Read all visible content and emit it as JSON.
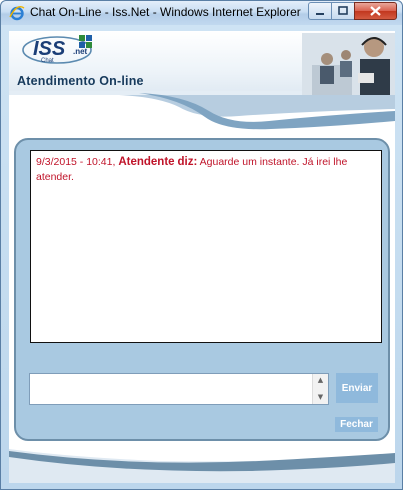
{
  "window": {
    "title": "Chat On-Line - Iss.Net - Windows Internet Explorer"
  },
  "header": {
    "logo_text": "ISS",
    "logo_suffix": ".net",
    "logo_subtext": "Chat",
    "title": "Atendimento On-line",
    "photo_icon": "call-center-agents-photo"
  },
  "chat": {
    "messages": [
      {
        "timestamp": "9/3/2015 - 10:41,",
        "sender": "Atendente",
        "verb": "diz:",
        "text": "Aguarde um instante. Já irei lhe atender."
      }
    ],
    "input": {
      "value": "",
      "placeholder": ""
    },
    "send_label": "Enviar",
    "close_label": "Fechar"
  },
  "colors": {
    "panel": "#a9c9e1",
    "panel_border": "#6d8fa9",
    "button": "#8fb9dc",
    "message_text": "#c0142a",
    "header_title": "#173a5c"
  }
}
